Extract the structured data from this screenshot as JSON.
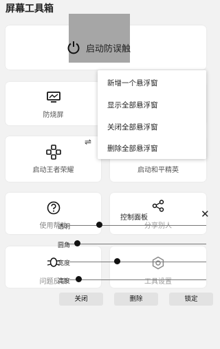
{
  "app": {
    "title": "屏幕工具箱"
  },
  "start": {
    "label": "启动防误触",
    "icon": "power-icon"
  },
  "cards": {
    "anti_burn": {
      "label": "防烧屏",
      "icon": "monitor-icon"
    },
    "honor_of_kings": {
      "label": "启动王者荣耀",
      "icon": "gamepad-icon"
    },
    "peace_elite": {
      "label": "启动和平精英"
    },
    "help": {
      "label": "使用帮助",
      "icon": "question-icon"
    },
    "share": {
      "label": "分享别人",
      "icon": "share-icon"
    },
    "bug": {
      "label": "问题反馈",
      "icon": "bug-icon"
    },
    "settings": {
      "label": "工具设置",
      "icon": "gear-icon"
    }
  },
  "swap_icon": "⇌",
  "menu": {
    "items": [
      "新增一个悬浮窗",
      "显示全部悬浮窗",
      "关闭全部悬浮窗",
      "删除全部悬浮窗"
    ]
  },
  "control_panel": {
    "title": "控制面板",
    "close_symbol": "✕",
    "sliders": [
      {
        "label": "透明",
        "value": 0.23
      },
      {
        "label": "圆角",
        "value": 0.07
      },
      {
        "label": "宽度",
        "value": 0.36
      },
      {
        "label": "高度",
        "value": 0.08
      }
    ],
    "buttons": [
      "关闭",
      "删除",
      "锁定"
    ]
  }
}
